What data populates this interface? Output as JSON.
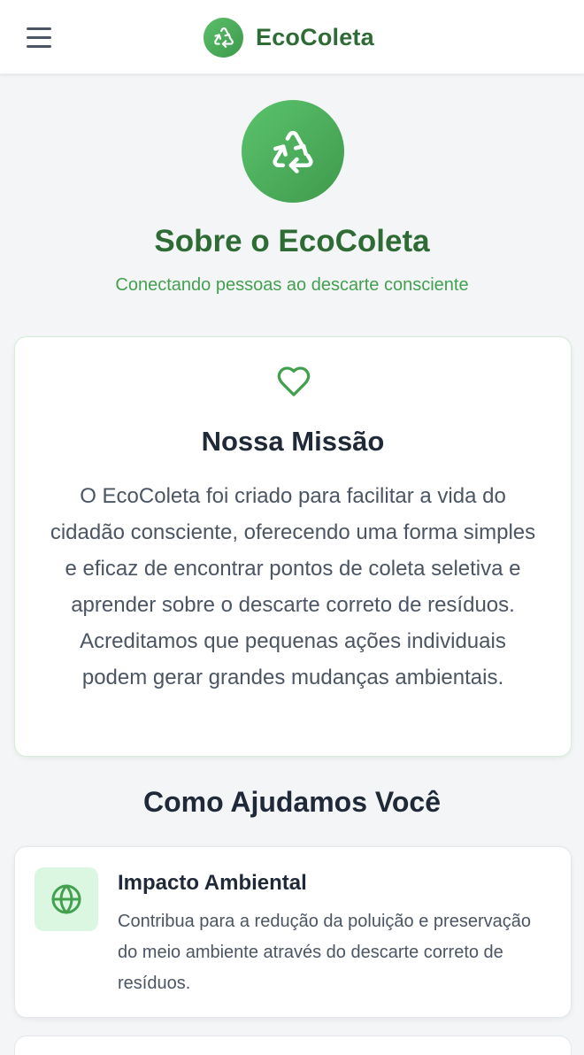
{
  "header": {
    "brand_name": "EcoColeta",
    "menu_icon": "hamburger-menu-icon",
    "logo_icon": "recycle-icon"
  },
  "hero": {
    "icon": "recycle-icon",
    "title": "Sobre o EcoColeta",
    "subtitle": "Conectando pessoas ao descarte consciente"
  },
  "mission": {
    "icon": "heart-icon",
    "title": "Nossa Missão",
    "text": "O EcoColeta foi criado para facilitar a vida do cidadão consciente, oferecendo uma forma simples e eficaz de encontrar pontos de coleta seletiva e aprender sobre o descarte correto de resíduos. Acreditamos que pequenas ações individuais podem gerar grandes mudanças ambientais."
  },
  "help_section": {
    "title": "Como Ajudamos Você",
    "features": [
      {
        "icon": "globe-icon",
        "title": "Impacto Ambiental",
        "text": "Contribua para a redução da poluição e preservação do meio ambiente através do descarte correto de resíduos."
      }
    ]
  },
  "colors": {
    "brand_dark": "#2f6b35",
    "brand": "#43a04f",
    "icon_bg": "#dcf7e1"
  }
}
